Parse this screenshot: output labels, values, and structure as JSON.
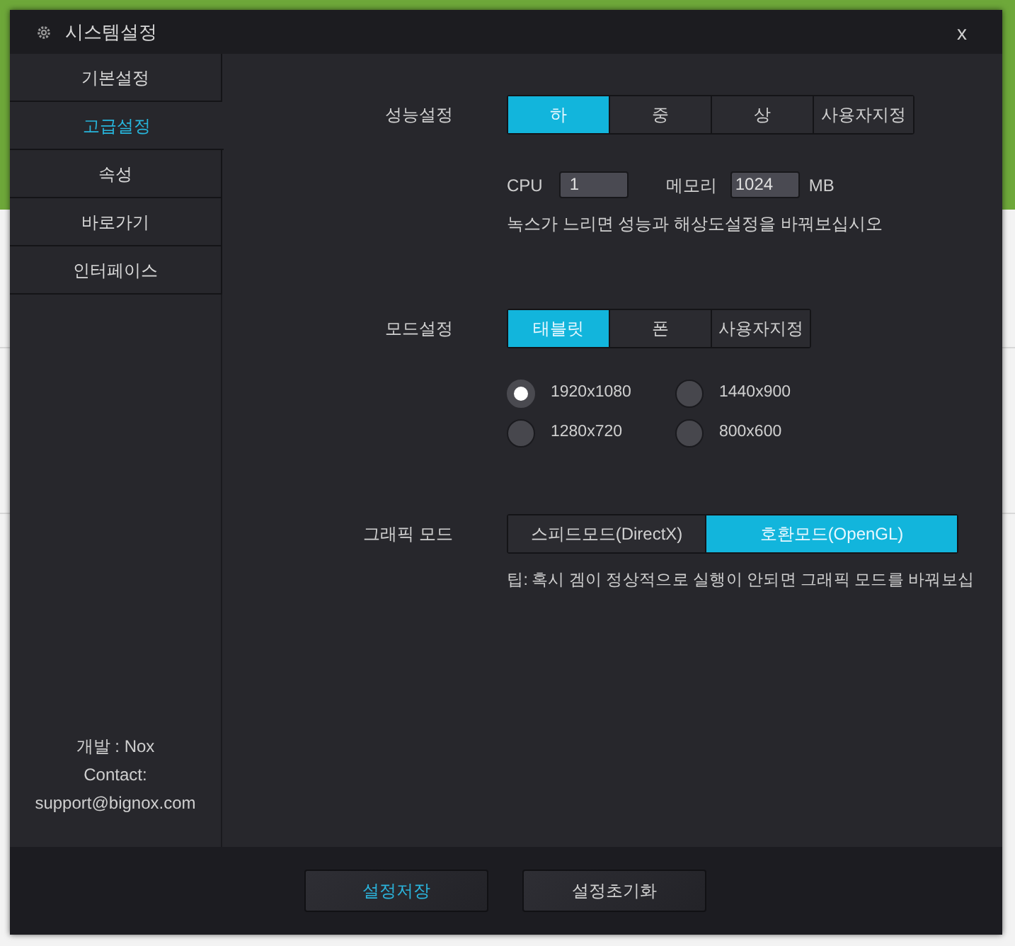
{
  "window": {
    "title": "시스템설정",
    "close": "x"
  },
  "sidebar": {
    "items": [
      {
        "label": "기본설정",
        "selected": false
      },
      {
        "label": "고급설정",
        "selected": true
      },
      {
        "label": "속성",
        "selected": false
      },
      {
        "label": "바로가기",
        "selected": false
      },
      {
        "label": "인터페이스",
        "selected": false
      }
    ],
    "footer": [
      "개발 : Nox",
      "Contact:",
      "support@bignox.com"
    ]
  },
  "performance": {
    "label": "성능설정",
    "options": [
      {
        "label": "하",
        "selected": true
      },
      {
        "label": "중",
        "selected": false
      },
      {
        "label": "상",
        "selected": false
      },
      {
        "label": "사용자지정",
        "selected": false
      }
    ],
    "cpu": {
      "label": "CPU",
      "value": "1"
    },
    "memory": {
      "label": "메모리",
      "value": "1024",
      "unit": "MB"
    },
    "hint": "녹스가 느리면 성능과 해상도설정을 바꿔보십시오"
  },
  "mode": {
    "label": "모드설정",
    "options": [
      {
        "label": "태블릿",
        "selected": true
      },
      {
        "label": "폰",
        "selected": false
      },
      {
        "label": "사용자지정",
        "selected": false
      }
    ],
    "resolutions": [
      {
        "label": "1920x1080",
        "selected": true
      },
      {
        "label": "1440x900",
        "selected": false
      },
      {
        "label": "1280x720",
        "selected": false
      },
      {
        "label": "800x600",
        "selected": false
      }
    ]
  },
  "graphics": {
    "label": "그래픽 모드",
    "options": [
      {
        "label": "스피드모드(DirectX)",
        "selected": false
      },
      {
        "label": "호환모드(OpenGL)",
        "selected": true
      }
    ],
    "tip": "팁: 혹시 겜이 정상적으로 실행이 안되면 그래픽 모드를 바꿔보십"
  },
  "buttons": [
    {
      "label": "설정저장",
      "primary": true
    },
    {
      "label": "설정초기화",
      "primary": false
    }
  ]
}
